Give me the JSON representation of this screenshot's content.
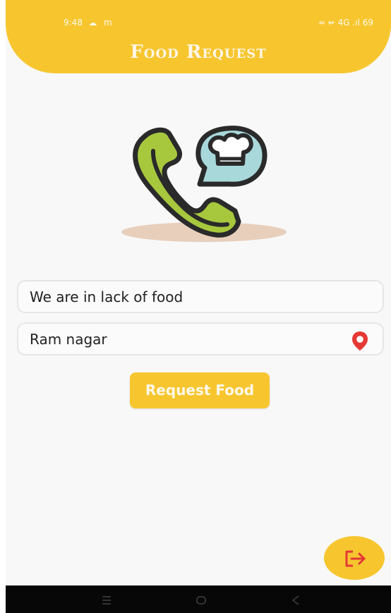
{
  "status_bar": {
    "time": "9:48",
    "left_indicators": [
      "notification-icon",
      "m"
    ],
    "right_text": "≈ ↚ 4G .ıl 69"
  },
  "header": {
    "title": "Food Request"
  },
  "illustration": {
    "name": "phone-food-request-illustration"
  },
  "form": {
    "need_value": "We are in lack of food",
    "location_value": "Ram nagar"
  },
  "actions": {
    "request_button_label": "Request Food",
    "logout_icon": "logout-icon"
  },
  "navigation": {
    "icons": [
      "menu-icon",
      "home-icon",
      "back-icon"
    ]
  },
  "colors": {
    "accent_yellow": "#f7c62f",
    "location_red": "#e53935",
    "phone_green": "#a7c83d",
    "chef_bubble": "#a9d8db",
    "shadow": "#e7cfbc"
  }
}
